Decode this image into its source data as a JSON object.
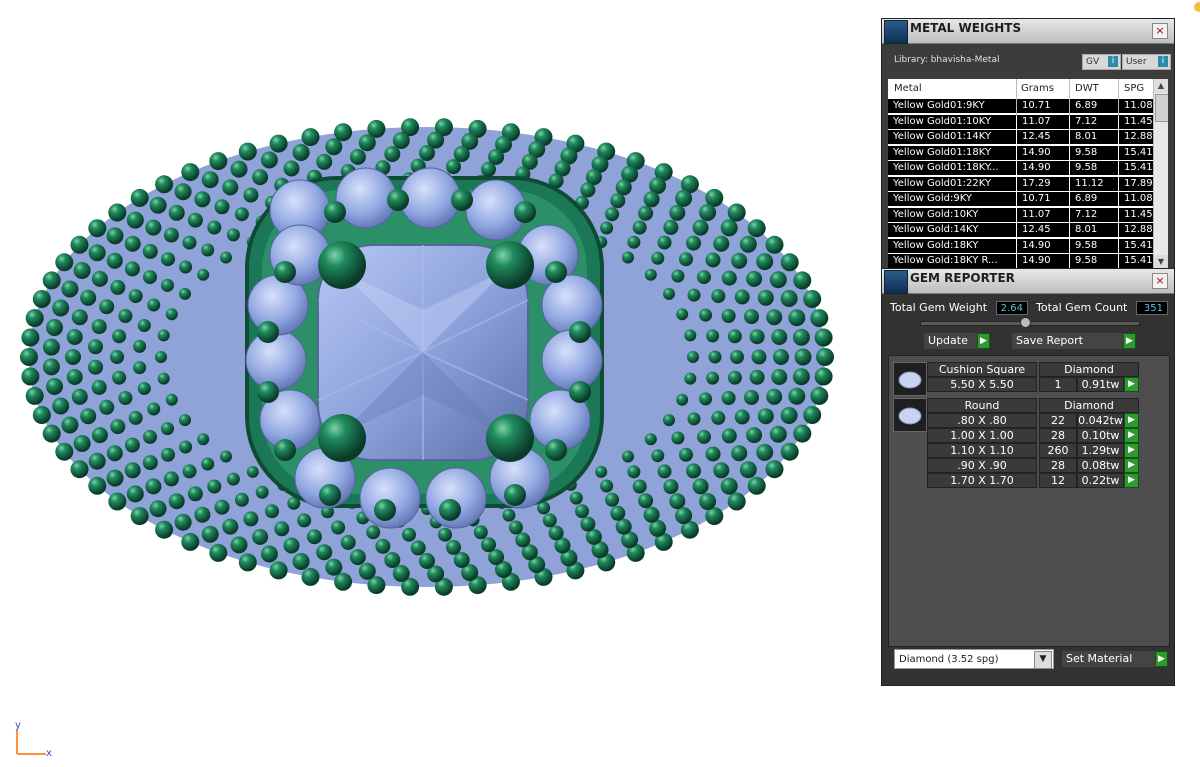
{
  "metal_weights": {
    "title": "METAL WEIGHTS",
    "close_icon": "×",
    "library_label": "Library: bhavisha-Metal",
    "gv_label": "GV",
    "user_label": "User",
    "columns": [
      "Metal",
      "Grams",
      "DWT",
      "SPG"
    ],
    "rows": [
      {
        "metal": "Yellow Gold01:9KY",
        "grams": "10.71",
        "dwt": "6.89",
        "spg": "11.08"
      },
      {
        "metal": "Yellow Gold01:10KY",
        "grams": "11.07",
        "dwt": "7.12",
        "spg": "11.45"
      },
      {
        "metal": "Yellow Gold01:14KY",
        "grams": "12.45",
        "dwt": "8.01",
        "spg": "12.88"
      },
      {
        "metal": "Yellow Gold01:18KY",
        "grams": "14.90",
        "dwt": "9.58",
        "spg": "15.41"
      },
      {
        "metal": "Yellow Gold01:18KY...",
        "grams": "14.90",
        "dwt": "9.58",
        "spg": "15.41"
      },
      {
        "metal": "Yellow Gold01:22KY",
        "grams": "17.29",
        "dwt": "11.12",
        "spg": "17.89"
      },
      {
        "metal": "Yellow Gold:9KY",
        "grams": "10.71",
        "dwt": "6.89",
        "spg": "11.08"
      },
      {
        "metal": "Yellow Gold:10KY",
        "grams": "11.07",
        "dwt": "7.12",
        "spg": "11.45"
      },
      {
        "metal": "Yellow Gold:14KY",
        "grams": "12.45",
        "dwt": "8.01",
        "spg": "12.88"
      },
      {
        "metal": "Yellow Gold:18KY",
        "grams": "14.90",
        "dwt": "9.58",
        "spg": "15.41"
      },
      {
        "metal": "Yellow Gold:18KY R...",
        "grams": "14.90",
        "dwt": "9.58",
        "spg": "15.41"
      }
    ]
  },
  "gem_reporter": {
    "title": "GEM REPORTER",
    "close_icon": "×",
    "total_weight_label": "Total Gem Weight",
    "total_weight_value": "2.64",
    "total_count_label": "Total Gem Count",
    "total_count_value": "351",
    "update_label": "Update",
    "save_report_label": "Save Report",
    "groups": [
      {
        "shape": "Cushion Square",
        "material": "Diamond",
        "items": [
          {
            "size": "5.50 X 5.50",
            "count": "1",
            "weight": "0.91tw"
          }
        ]
      },
      {
        "shape": "Round",
        "material": "Diamond",
        "items": [
          {
            "size": ".80 X .80",
            "count": "22",
            "weight": "0.042tw"
          },
          {
            "size": "1.00 X 1.00",
            "count": "28",
            "weight": "0.10tw"
          },
          {
            "size": "1.10 X 1.10",
            "count": "260",
            "weight": "1.29tw"
          },
          {
            "size": ".90 X .90",
            "count": "28",
            "weight": "0.08tw"
          },
          {
            "size": "1.70 X 1.70",
            "count": "12",
            "weight": "0.22tw"
          }
        ]
      }
    ],
    "material_select": "Diamond      (3.52 spg)",
    "set_material_label": "Set Material"
  },
  "axis": {
    "y_label": "y",
    "x_label": "x"
  },
  "colors": {
    "metal_green": "#17664a",
    "gem_blue": "#8fa7e0",
    "panel_bg": "#3c3c3c",
    "value_cyan": "#5bc3d4",
    "go_green": "#2e9a2e"
  }
}
